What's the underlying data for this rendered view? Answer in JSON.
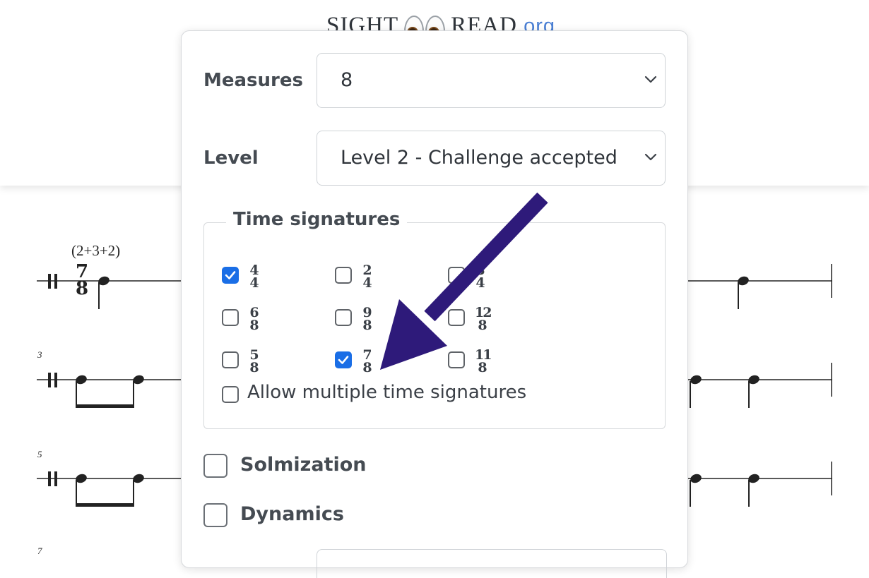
{
  "logo": {
    "text_left": "SIGHT",
    "text_right": "READ",
    "tld": ".org",
    "icon": "eyes-icon"
  },
  "score": {
    "tempo_grouping": "(2+3+2)",
    "time_signature": {
      "numerator": "7",
      "denominator": "8"
    },
    "measure_numbers": [
      "3",
      "5",
      "7"
    ]
  },
  "settings": {
    "measures": {
      "label": "Measures",
      "value": "8"
    },
    "level": {
      "label": "Level",
      "value": "Level 2 - Challenge accepted"
    },
    "time_signatures": {
      "legend": "Time signatures",
      "options": [
        {
          "numerator": "4",
          "denominator": "4",
          "checked": true
        },
        {
          "numerator": "2",
          "denominator": "4",
          "checked": false
        },
        {
          "numerator": "3",
          "denominator": "4",
          "checked": false
        },
        {
          "numerator": "6",
          "denominator": "8",
          "checked": false
        },
        {
          "numerator": "9",
          "denominator": "8",
          "checked": false
        },
        {
          "numerator": "12",
          "denominator": "8",
          "checked": false
        },
        {
          "numerator": "5",
          "denominator": "8",
          "checked": false
        },
        {
          "numerator": "7",
          "denominator": "8",
          "checked": true
        },
        {
          "numerator": "11",
          "denominator": "8",
          "checked": false
        }
      ],
      "allow_multiple": {
        "label": "Allow multiple time signatures",
        "checked": false
      }
    },
    "solmization": {
      "label": "Solmization",
      "checked": false
    },
    "dynamics": {
      "label": "Dynamics",
      "checked": false
    }
  },
  "colors": {
    "accent": "#1a6ee6",
    "arrow": "#2e1a7a",
    "logo_tld": "#4a7fd4"
  }
}
